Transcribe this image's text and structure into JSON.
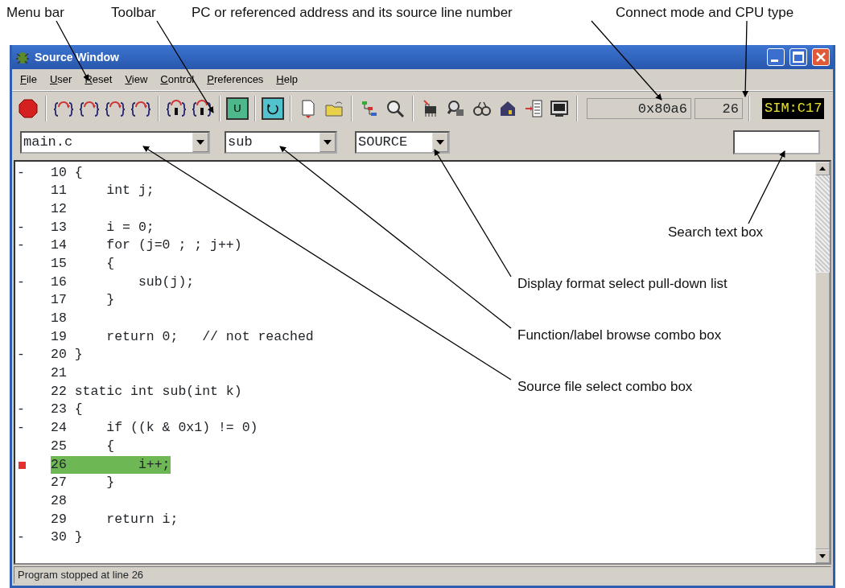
{
  "callouts": [
    {
      "text": "Menu bar",
      "kind": "top"
    },
    {
      "text": "Toolbar",
      "kind": "top"
    },
    {
      "text": "PC or referenced address and its source line number",
      "kind": "top"
    },
    {
      "text": "Connect mode and CPU type",
      "kind": "top"
    },
    {
      "text": "Search text box",
      "kind": "side"
    },
    {
      "text": "Display format select pull-down list",
      "kind": "side"
    },
    {
      "text": "Function/label browse combo box",
      "kind": "side"
    },
    {
      "text": "Source file select combo box",
      "kind": "side"
    }
  ],
  "window": {
    "title": "Source Window"
  },
  "menu": [
    "File",
    "User",
    "Reset",
    "View",
    "Control",
    "Preferences",
    "Help"
  ],
  "toolbar": {
    "u_button": "U",
    "pc_address": "0x80a6",
    "source_line": "26",
    "mode": "SIM:C17"
  },
  "combos": {
    "source_file": "main.c",
    "function": "sub",
    "display_format": "SOURCE"
  },
  "code": [
    {
      "mark": "-",
      "num": "10",
      "code": "{",
      "breakpoint": false,
      "current": false
    },
    {
      "num": "11",
      "code": "    int j;",
      "breakpoint": false,
      "current": false
    },
    {
      "num": "12",
      "breakpoint": false,
      "current": false
    },
    {
      "mark": "-",
      "num": "13",
      "code": "    i = 0;",
      "breakpoint": false,
      "current": false
    },
    {
      "mark": "-",
      "num": "14",
      "code": "    for (j=0 ; ; j++)",
      "breakpoint": false,
      "current": false
    },
    {
      "num": "15",
      "code": "    {",
      "breakpoint": false,
      "current": false
    },
    {
      "mark": "-",
      "num": "16",
      "code": "        sub(j);",
      "breakpoint": false,
      "current": false
    },
    {
      "num": "17",
      "code": "    }",
      "breakpoint": false,
      "current": false
    },
    {
      "num": "18",
      "breakpoint": false,
      "current": false
    },
    {
      "num": "19",
      "code": "    return 0;   // not reached",
      "breakpoint": false,
      "current": false
    },
    {
      "mark": "-",
      "num": "20",
      "code": "}",
      "breakpoint": false,
      "current": false
    },
    {
      "num": "21",
      "breakpoint": false,
      "current": false
    },
    {
      "num": "22",
      "code": "static int sub(int k)",
      "breakpoint": false,
      "current": false
    },
    {
      "mark": "-",
      "num": "23",
      "code": "{",
      "breakpoint": false,
      "current": false
    },
    {
      "mark": "-",
      "num": "24",
      "code": "    if ((k & 0x1) != 0)",
      "breakpoint": false,
      "current": false
    },
    {
      "num": "25",
      "code": "    {",
      "breakpoint": false,
      "current": false
    },
    {
      "num": "26",
      "code": "        i++;",
      "breakpoint": true,
      "current": true
    },
    {
      "num": "27",
      "code": "    }",
      "breakpoint": false,
      "current": false
    },
    {
      "num": "28",
      "breakpoint": false,
      "current": false
    },
    {
      "num": "29",
      "code": "    return i;",
      "breakpoint": false,
      "current": false
    },
    {
      "mark": "-",
      "num": "30",
      "code": "}",
      "breakpoint": false,
      "current": false
    }
  ],
  "status_bar": "Program stopped at line 26"
}
